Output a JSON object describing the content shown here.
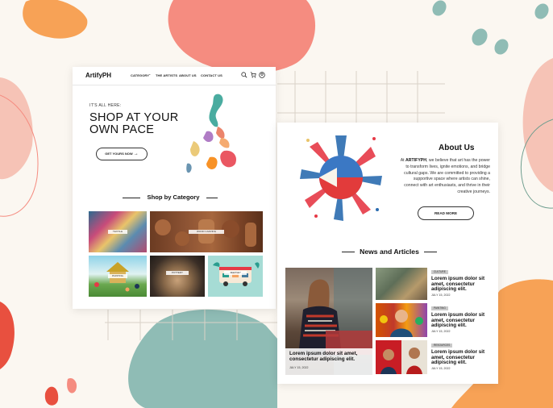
{
  "app": {
    "logo": "ArtifyPH",
    "nav": {
      "category": "CATEGORY",
      "artists": "THE ARTISTS",
      "about": "ABOUT US",
      "contact": "CONTACT US"
    },
    "icons": [
      "search-icon",
      "cart-icon",
      "user-icon"
    ]
  },
  "hero": {
    "eyebrow": "IT'S ALL HERE:",
    "headline": "SHOP AT YOUR OWN PACE",
    "cta": "GET YOURS NOW"
  },
  "shop": {
    "title": "Shop by Category",
    "categories": [
      {
        "label": "TEXTILE"
      },
      {
        "label": "WOOD CARVING"
      },
      {
        "label": "PAINTING"
      },
      {
        "label": "POTTERY"
      },
      {
        "label": "JEEPNEY"
      }
    ]
  },
  "about": {
    "title": "About Us",
    "brand": "ARTIFYPH",
    "intro": "At ",
    "body": ", we believe that art has the power to transform lives, ignite emotions, and bridge cultural gaps. We are committed to providing a supportive space where artists can shine, connect with art enthusiasts, and thrive in their creative journeys.",
    "cta": "READ MORE"
  },
  "news": {
    "title": "News and Articles",
    "featured": {
      "title": "Lorem ipsum dolor sit amet, consectetur adipiscing elit.",
      "date": "JULY 15, 2022"
    },
    "articles": [
      {
        "tag": "CULTURE",
        "title": "Lorem ipsum dolor sit amet, consectetur adipiscing elit.",
        "date": "JULY 15, 2022"
      },
      {
        "tag": "PAINTING",
        "title": "Lorem ipsum dolor sit amet, consectetur adipiscing elit.",
        "date": "JULY 15, 2022"
      },
      {
        "tag": "RESOURCES",
        "title": "Lorem ipsum dolor sit amet, consectetur adipiscing elit.",
        "date": "JULY 15, 2022"
      }
    ]
  },
  "colors": {
    "background": "#fbf7f1",
    "orange": "#f7a256",
    "coral": "#f58c80",
    "pink": "#f6c3b6",
    "teal": "#8fbcb5",
    "text": "#111111"
  }
}
